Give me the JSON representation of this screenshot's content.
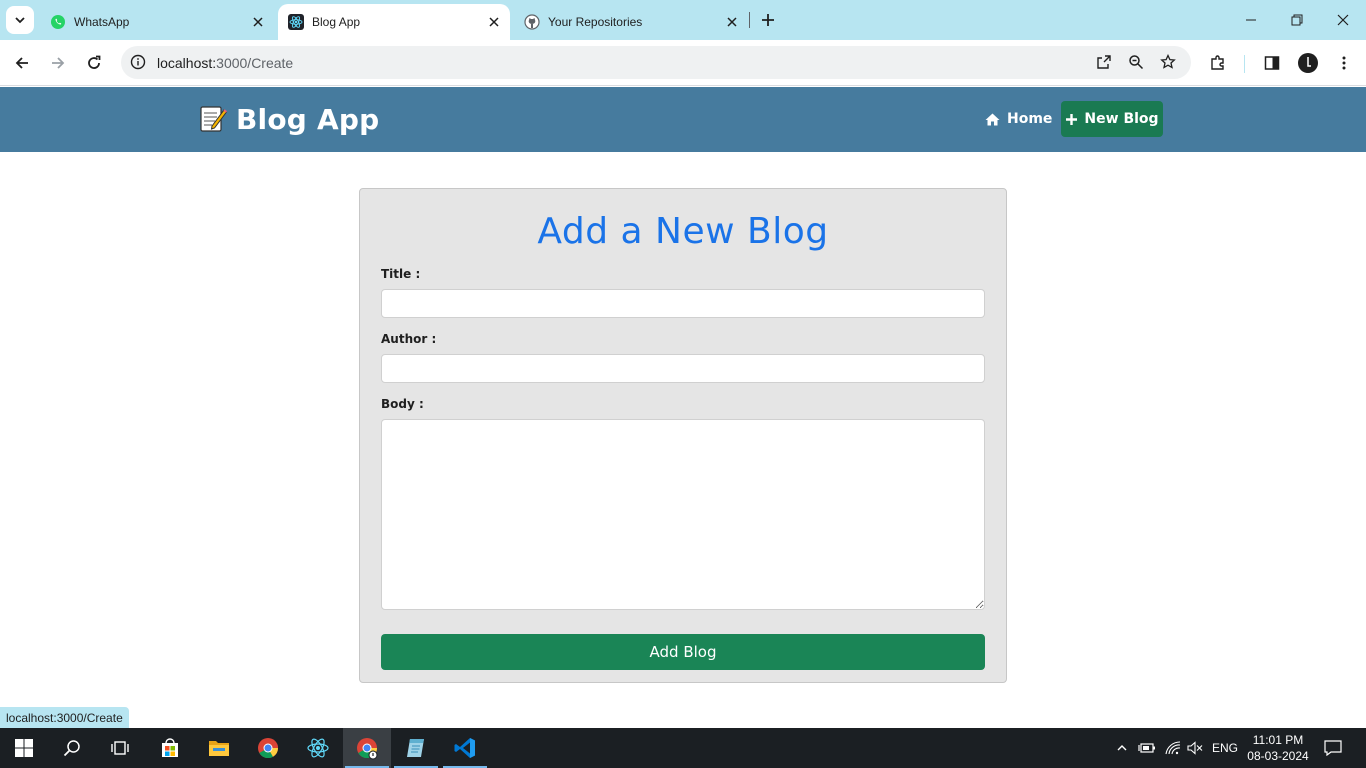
{
  "browser": {
    "tabs": [
      {
        "title": "WhatsApp",
        "icon": "whatsapp-icon",
        "active": false
      },
      {
        "title": "Blog App",
        "icon": "react-icon",
        "active": true
      },
      {
        "title": "Your Repositories",
        "icon": "github-icon",
        "active": false
      }
    ],
    "url_host": "localhost:",
    "url_path": "3000/Create",
    "status_url": "localhost:3000/Create"
  },
  "app": {
    "brand": "Blog App",
    "brand_icon": "memo-icon",
    "nav": {
      "home_label": "Home",
      "new_blog_label": "New Blog"
    },
    "form": {
      "heading": "Add a New Blog",
      "title_label": "Title :",
      "title_value": "",
      "author_label": "Author :",
      "author_value": "",
      "body_label": "Body :",
      "body_value": "",
      "submit_label": "Add Blog"
    },
    "colors": {
      "nav_bg": "#467b9e",
      "primary_button": "#1a8556",
      "heading": "#1a73e8",
      "card_bg": "#e5e5e5"
    }
  },
  "taskbar": {
    "apps": [
      "start-icon",
      "search-icon",
      "task-view-icon",
      "store-icon",
      "file-explorer-icon",
      "chrome-icon",
      "react-app-icon",
      "chrome-active-icon",
      "notes-icon",
      "vscode-icon"
    ],
    "language": "ENG",
    "time": "11:01 PM",
    "date": "08-03-2024"
  }
}
